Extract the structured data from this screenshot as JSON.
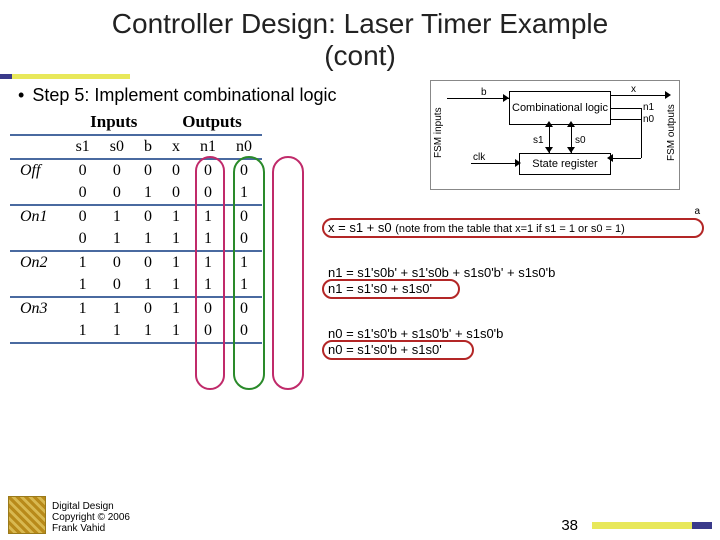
{
  "title_line1": "Controller Design: Laser Timer Example",
  "title_line2": "(cont)",
  "step_bullet": "•",
  "step_text": "Step 5: Implement combinational logic",
  "table": {
    "inputs_label": "Inputs",
    "outputs_label": "Outputs",
    "cols_in": [
      "s1",
      "s0",
      "b"
    ],
    "cols_out": [
      "x",
      "n1",
      "n0"
    ],
    "rows": [
      {
        "state": "Off",
        "in": [
          "0",
          "0",
          "0"
        ],
        "out": [
          "0",
          "0",
          "0"
        ]
      },
      {
        "state": "",
        "in": [
          "0",
          "0",
          "1"
        ],
        "out": [
          "0",
          "0",
          "1"
        ]
      },
      {
        "state": "On1",
        "in": [
          "0",
          "1",
          "0"
        ],
        "out": [
          "1",
          "1",
          "0"
        ]
      },
      {
        "state": "",
        "in": [
          "0",
          "1",
          "1"
        ],
        "out": [
          "1",
          "1",
          "0"
        ]
      },
      {
        "state": "On2",
        "in": [
          "1",
          "0",
          "0"
        ],
        "out": [
          "1",
          "1",
          "1"
        ]
      },
      {
        "state": "",
        "in": [
          "1",
          "0",
          "1"
        ],
        "out": [
          "1",
          "1",
          "1"
        ]
      },
      {
        "state": "On3",
        "in": [
          "1",
          "1",
          "0"
        ],
        "out": [
          "1",
          "0",
          "0"
        ]
      },
      {
        "state": "",
        "in": [
          "1",
          "1",
          "1"
        ],
        "out": [
          "1",
          "0",
          "0"
        ]
      }
    ]
  },
  "block": {
    "inputs_label": "FSM inputs",
    "outputs_label": "FSM outputs",
    "combo": "Combinational logic",
    "statereg": "State register",
    "b": "b",
    "x": "x",
    "n1": "n1",
    "n0": "n0",
    "s1": "s1",
    "s0": "s0",
    "clk": "clk"
  },
  "eq_x": "x = s1 + s0",
  "eq_x_note": "(note from the table that x=1 if s1 = 1 or s0 = 1)",
  "eq_n1_full": "n1 = s1's0b' + s1's0b + s1s0'b' + s1s0'b",
  "eq_n1_simp": "n1 = s1's0 + s1s0'",
  "eq_n0_full": "n0 = s1's0'b + s1s0'b' + s1s0'b",
  "eq_n0_simp": "n0 = s1's0'b + s1s0'",
  "footer": {
    "line1": "Digital Design",
    "line2": "Copyright © 2006",
    "line3": "Frank Vahid",
    "page": "38"
  },
  "corner_a": "a"
}
